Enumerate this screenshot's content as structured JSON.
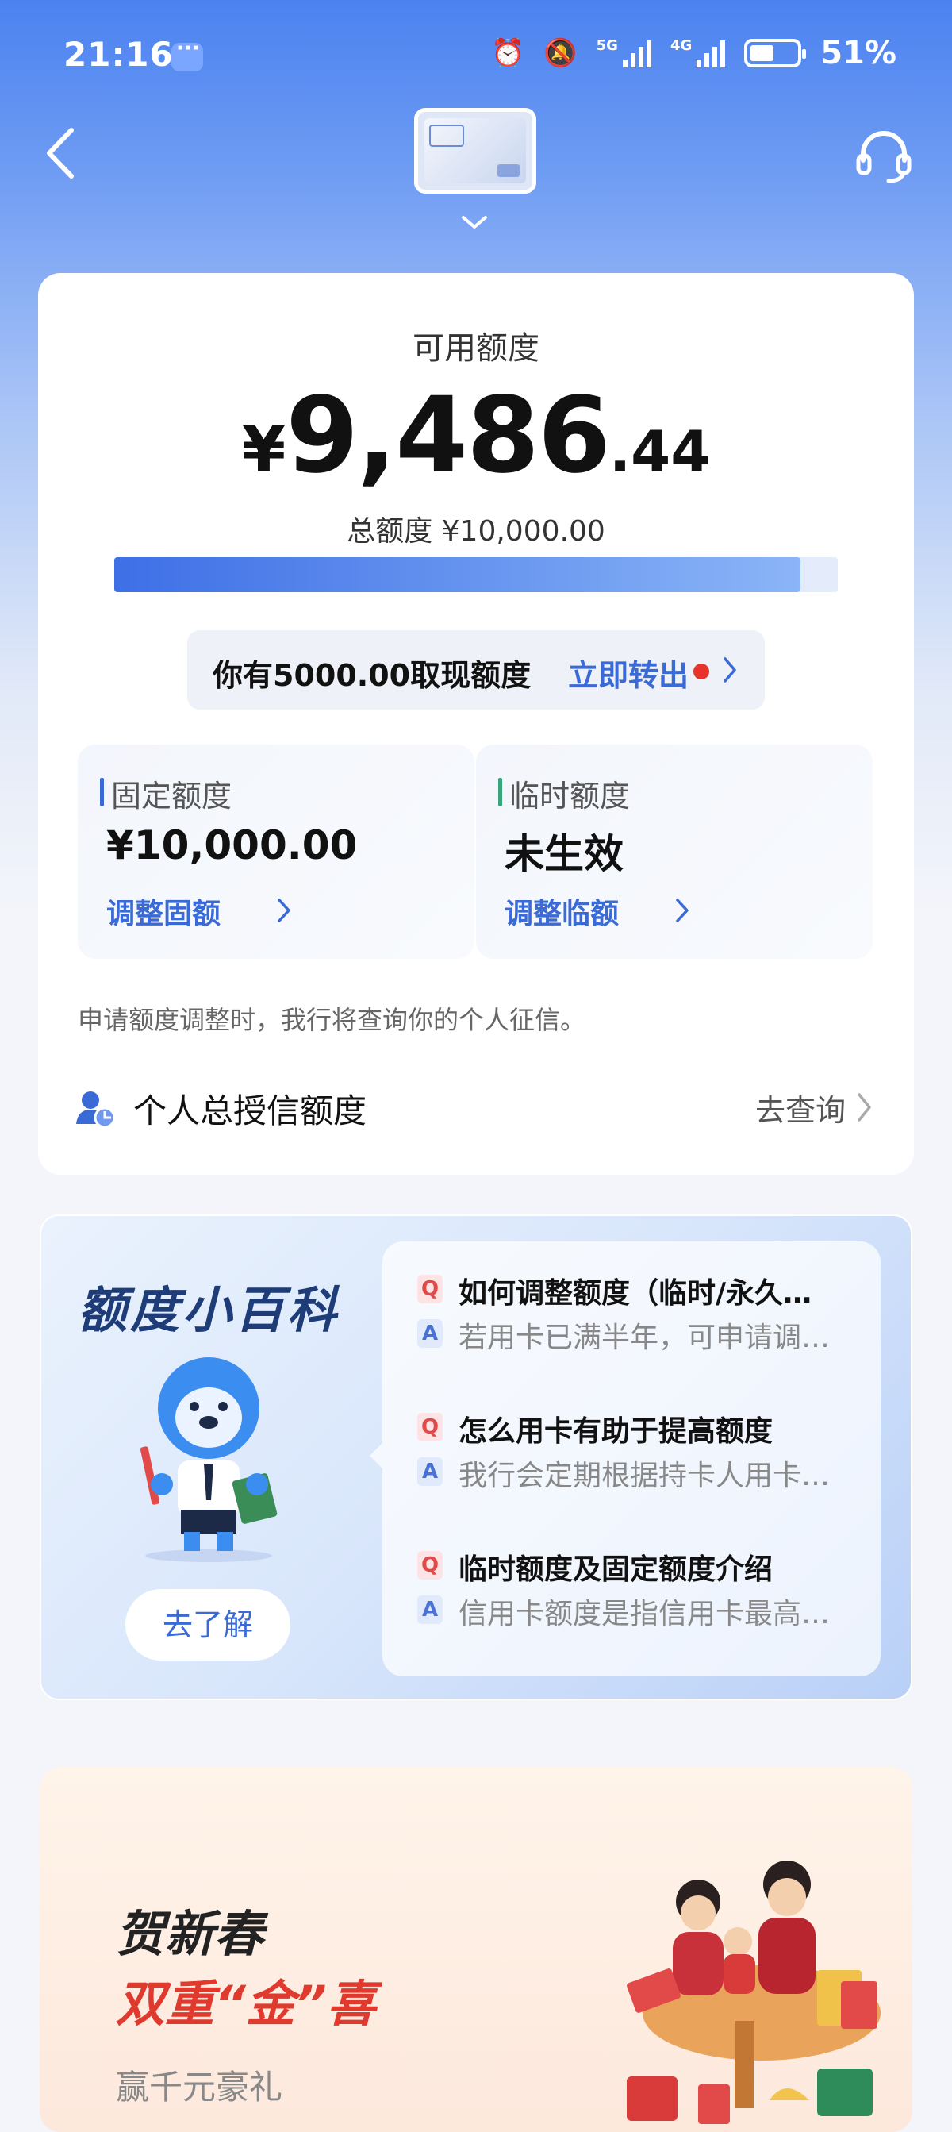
{
  "status_bar": {
    "time": "21:16",
    "net1": "5G",
    "net2": "4G",
    "battery": "51%",
    "battery_level": 0.51
  },
  "header": {
    "back_icon": "back-chevron-icon",
    "service_icon": "headset-icon"
  },
  "credit": {
    "available_label": "可用额度",
    "currency_symbol": "¥",
    "available_int": "9,486",
    "available_dec": ".44",
    "total_text": "总额度 ¥10,000.00",
    "usage_fraction": 0.9486,
    "cash_text": "你有5000.00取现额度",
    "cash_link": "立即转出",
    "fixed": {
      "title": "固定额度",
      "value": "¥10,000.00",
      "adjust": "调整固额",
      "accent": "#3a6ad6"
    },
    "temp": {
      "title": "临时额度",
      "value": "未生效",
      "adjust": "调整临额",
      "accent": "#3aa57a"
    },
    "notice": "申请额度调整时，我行将查询你的个人征信。",
    "total_credit_label": "个人总授信额度",
    "query_label": "去查询"
  },
  "encyclopedia": {
    "title": "额度小百科",
    "learn_button": "去了解",
    "items": [
      {
        "q_badge": "Q",
        "question": "如何调整额度（临时/永久…",
        "a_badge": "A",
        "answer": "若用卡已满半年，可申请调…"
      },
      {
        "q_badge": "Q",
        "question": "怎么用卡有助于提高额度",
        "a_badge": "A",
        "answer": "我行会定期根据持卡人用卡…"
      },
      {
        "q_badge": "Q",
        "question": "临时额度及固定额度介绍",
        "a_badge": "A",
        "answer": "信用卡额度是指信用卡最高…"
      }
    ]
  },
  "promo": {
    "line1": "贺新春",
    "line2": "双重“金”喜",
    "line3": "赢千元豪礼"
  }
}
